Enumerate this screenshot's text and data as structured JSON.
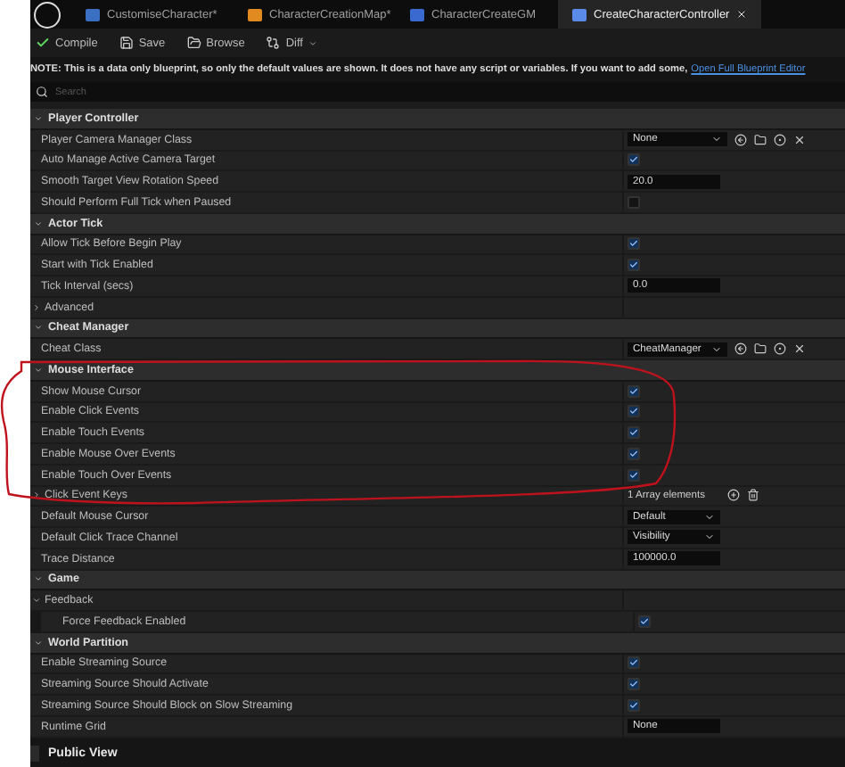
{
  "tabs": [
    {
      "label": "CustomiseCharacter*",
      "selected": false
    },
    {
      "label": "CharacterCreationMap*",
      "selected": false
    },
    {
      "label": "CharacterCreateGM",
      "selected": false
    },
    {
      "label": "CreateCharacterController",
      "selected": true
    }
  ],
  "toolbar": [
    {
      "label": "Compile",
      "kind": "compile"
    },
    {
      "label": "Save",
      "kind": "save"
    },
    {
      "label": "Browse",
      "kind": "browse"
    },
    {
      "label": "Diff",
      "kind": "diff"
    }
  ],
  "note": {
    "text": "NOTE: This is a data only blueprint, so only the default values are shown.  It does not have any script or variables.  If you want to add some,",
    "link": "Open Full Blueprint Editor"
  },
  "search": {
    "placeholder": "Search"
  },
  "sections": [
    {
      "title": "Player Controller",
      "expanded": true,
      "rows": [
        {
          "kind": "class",
          "label": "Player Camera Manager Class",
          "value": "None"
        },
        {
          "kind": "check",
          "label": "Auto Manage Active Camera Target",
          "checked": true
        },
        {
          "kind": "number",
          "label": "Smooth Target View Rotation Speed",
          "value": "20.0"
        },
        {
          "kind": "check",
          "label": "Should Perform Full Tick when Paused",
          "checked": false
        }
      ]
    },
    {
      "title": "Actor Tick",
      "expanded": true,
      "rows": [
        {
          "kind": "check",
          "label": "Allow Tick Before Begin Play",
          "checked": true
        },
        {
          "kind": "check",
          "label": "Start with Tick Enabled",
          "checked": true
        },
        {
          "kind": "number",
          "label": "Tick Interval (secs)",
          "value": "0.0"
        },
        {
          "kind": "group",
          "label": "Advanced",
          "expanded": false
        }
      ]
    },
    {
      "title": "Cheat Manager",
      "expanded": true,
      "rows": [
        {
          "kind": "class",
          "label": "Cheat Class",
          "value": "CheatManager"
        }
      ]
    },
    {
      "title": "Mouse Interface",
      "expanded": true,
      "rows": [
        {
          "kind": "check",
          "label": "Show Mouse Cursor",
          "checked": true
        },
        {
          "kind": "check",
          "label": "Enable Click Events",
          "checked": true
        },
        {
          "kind": "check",
          "label": "Enable Touch Events",
          "checked": true
        },
        {
          "kind": "check",
          "label": "Enable Mouse Over Events",
          "checked": true
        },
        {
          "kind": "check",
          "label": "Enable Touch Over Events",
          "checked": true
        },
        {
          "kind": "array",
          "label": "Click Event Keys",
          "value": "1 Array elements",
          "expanded": false
        },
        {
          "kind": "dropdown",
          "label": "Default Mouse Cursor",
          "value": "Default"
        },
        {
          "kind": "dropdown",
          "label": "Default Click Trace Channel",
          "value": "Visibility"
        },
        {
          "kind": "number",
          "label": "Trace Distance",
          "value": "100000.0"
        }
      ]
    },
    {
      "title": "Game",
      "expanded": true,
      "rows": [
        {
          "kind": "subgroup",
          "label": "Feedback",
          "expanded": true,
          "children": [
            {
              "kind": "check",
              "label": "Force Feedback Enabled",
              "checked": true
            }
          ]
        }
      ]
    },
    {
      "title": "World Partition",
      "expanded": true,
      "rows": [
        {
          "kind": "check",
          "label": "Enable Streaming Source",
          "checked": true
        },
        {
          "kind": "check",
          "label": "Streaming Source Should Activate",
          "checked": true
        },
        {
          "kind": "check",
          "label": "Streaming Source Should Block on Slow Streaming",
          "checked": true
        },
        {
          "kind": "number",
          "label": "Runtime Grid",
          "value": "None"
        }
      ]
    }
  ],
  "footer": {
    "label": "Public View",
    "checked": false
  }
}
